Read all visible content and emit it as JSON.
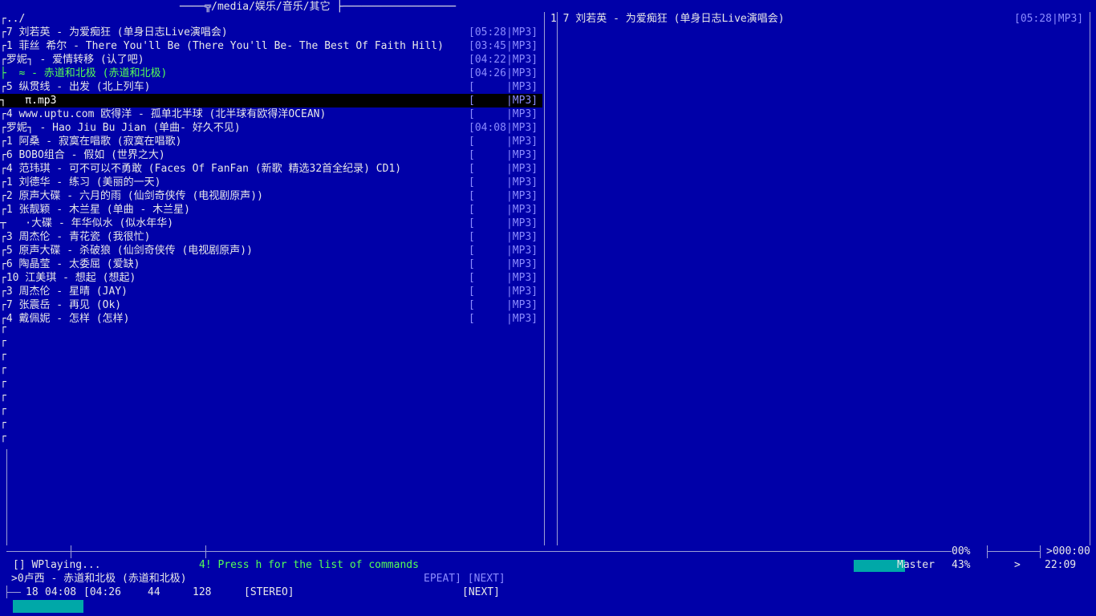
{
  "header": {
    "path": "────╦/media/娱乐/音乐/其它 ├──────────────────"
  },
  "left_list": {
    "parent": "┌../",
    "rows": [
      {
        "title": "┌7 刘若英 - 为爱痴狂 (单身日志Live演唱会)",
        "time": "[05:28|MP3]"
      },
      {
        "title": "┌1 菲丝 希尔 - There You'll Be (There You'll Be- The Best Of Faith Hill)",
        "time": "[03:45|MP3]"
      },
      {
        "title": "┌罗妮┐ - 爱情转移 (认了吧)",
        "time": "[04:22|MP3]"
      },
      {
        "title": "├  ≈ - 赤道和北极 (赤道和北极)",
        "time": "[04:26|MP3]",
        "playing": true
      },
      {
        "title": "┌5 纵贯线 - 出发 (北上列车)",
        "time": "[     |MP3]"
      },
      {
        "title": "┐   π.mp3",
        "time": "[     |MP3]",
        "selected": true
      },
      {
        "title": "┌4 www.uptu.com 欧得洋 - 孤单北半球 (北半球有欧得洋OCEAN)",
        "time": "[     |MP3]"
      },
      {
        "title": "┌罗妮┐ - Hao Jiu Bu Jian (单曲- 好久不见)",
        "time": "[04:08|MP3]"
      },
      {
        "title": "┌1 阿桑 - 寂寞在唱歌 (寂寞在唱歌)",
        "time": "[     |MP3]"
      },
      {
        "title": "┌6 BOBO组合 - 假如 (世界之大)",
        "time": "[     |MP3]"
      },
      {
        "title": "┌4 范玮琪 - 可不可以不勇敢 (Faces Of FanFan (新歌 精选32首全纪录) CD1)",
        "time": "[     |MP3]"
      },
      {
        "title": "┌1 刘德华 - 练习 (美丽的一天)",
        "time": "[     |MP3]"
      },
      {
        "title": "┌2 原声大碟 - 六月的雨 (仙剑奇侠传 (电视剧原声))",
        "time": "[     |MP3]"
      },
      {
        "title": "┌1 张靓颖 - 木兰星 (单曲 - 木兰星)",
        "time": "[     |MP3]"
      },
      {
        "title": "┬   ·大碟 - 年华似水 (似水年华)",
        "time": "[     |MP3]"
      },
      {
        "title": "┌3 周杰伦 - 青花瓷 (我很忙)",
        "time": "[     |MP3]"
      },
      {
        "title": "┌5 原声大碟 - 杀破狼 (仙剑奇侠传 (电视剧原声))",
        "time": "[     |MP3]"
      },
      {
        "title": "┌6 陶晶莹 - 太委屈 (爱缺)",
        "time": "[     |MP3]"
      },
      {
        "title": "┌10 江美琪 - 想起 (想起)",
        "time": "[     |MP3]"
      },
      {
        "title": "┌3 周杰伦 - 星晴 (JAY)",
        "time": "[     |MP3]"
      },
      {
        "title": "┌7 张震岳 - 再见 (Ok)",
        "time": "[     |MP3]"
      },
      {
        "title": "┌4 戴佩妮 - 怎样 (怎样)",
        "time": "[     |MP3]"
      }
    ]
  },
  "right_list": {
    "rows": [
      {
        "title": "1 7 刘若英 - 为爱痴狂 (单身日志Live演唱会)",
        "time": "[05:28|MP3]"
      }
    ]
  },
  "status": {
    "playing_state": "[] WPlaying...",
    "message": "4! Press h for the list of commands",
    "volume_pct_top": "00%",
    "time_top": ">000:00",
    "mixer_label": "Master",
    "volume": "43%",
    "arrow": ">",
    "clock": "22:09",
    "now_playing": ">0卢西 - 赤道和北极 (赤道和北极)",
    "flags_top": "EPEAT] [NEXT]",
    "track_num": "18",
    "elapsed": "04:08",
    "total": "[04:26",
    "rate": "44",
    "bitrate": "128",
    "stereo": "[STEREO]",
    "next": "[NEXT]",
    "volume_fraction": 0.43,
    "progress_fraction": 0.93
  },
  "colors": {
    "background": "#0000a8",
    "text": "#e8e8e8",
    "playing": "#55ff55",
    "accent": "#8c8cff",
    "bar": "#00a8a8"
  }
}
